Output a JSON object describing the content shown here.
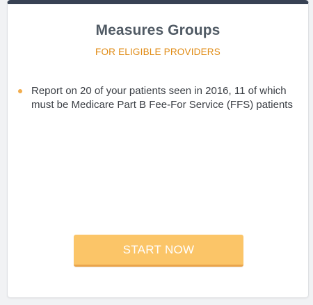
{
  "card": {
    "title": "Measures Groups",
    "subtitle": "FOR ELIGIBLE PROVIDERS",
    "bullets": [
      "Report on 20 of your patients seen in 2016, 11 of which must be Medicare Part B Fee-For Service (FFS) patients"
    ],
    "button_label": "START NOW"
  },
  "colors": {
    "header_bar": "#384254",
    "subtitle": "#e08a12",
    "bullet": "#f2ad4e",
    "button": "#fbc568",
    "button_border": "#e9a44c",
    "button_text": "#ffffff"
  }
}
